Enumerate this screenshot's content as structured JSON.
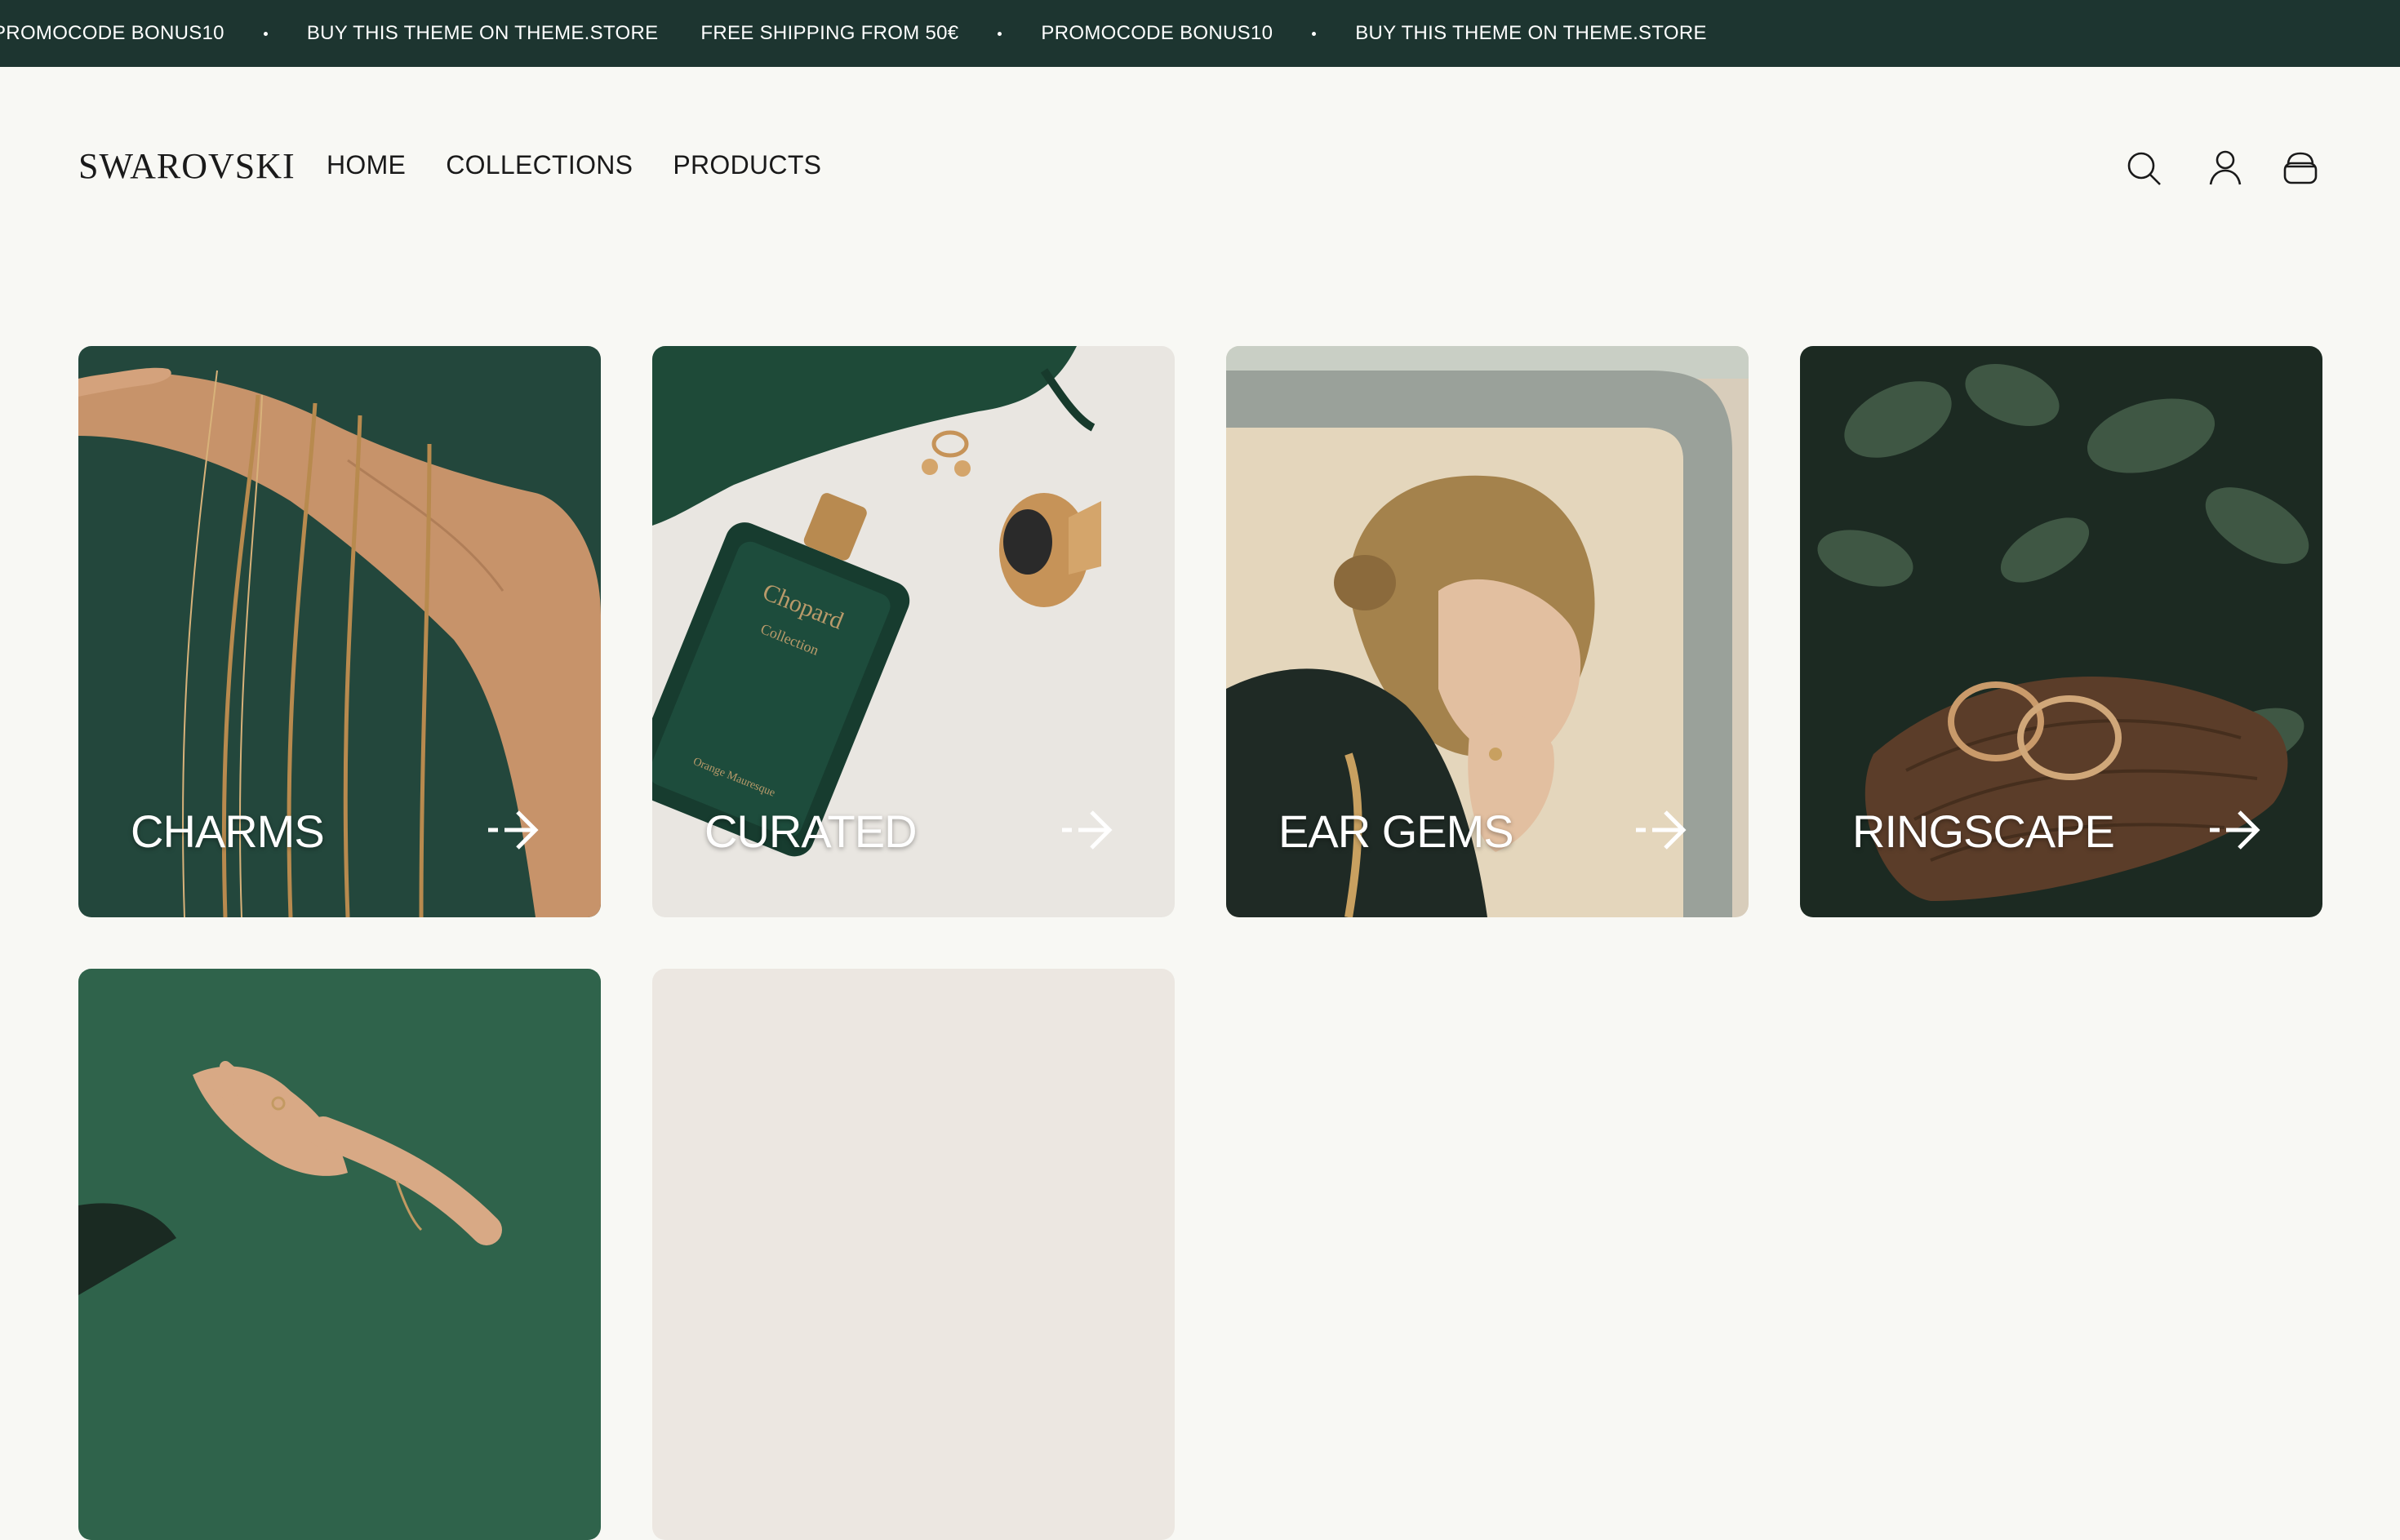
{
  "announcement": {
    "items": [
      "PROMOCODE BONUS10",
      "BUY THIS THEME ON THEME.STORE",
      "FREE SHIPPING FROM 50€",
      "PROMOCODE BONUS10",
      "BUY THIS THEME ON THEME.STORE"
    ]
  },
  "header": {
    "logo": "SWAROVSKI",
    "nav": [
      "HOME",
      "COLLECTIONS",
      "PRODUCTS"
    ],
    "icons": [
      "search-icon",
      "account-icon",
      "cart-icon"
    ]
  },
  "collections": [
    {
      "label": "CHARMS"
    },
    {
      "label": "CURATED"
    },
    {
      "label": "EAR GEMS"
    },
    {
      "label": "RINGSCAPE"
    },
    {
      "label": ""
    },
    {
      "label": ""
    }
  ],
  "colors": {
    "announcement_bg": "#1d3530",
    "page_bg": "#f8f8f4",
    "text": "#1a1a1a"
  }
}
